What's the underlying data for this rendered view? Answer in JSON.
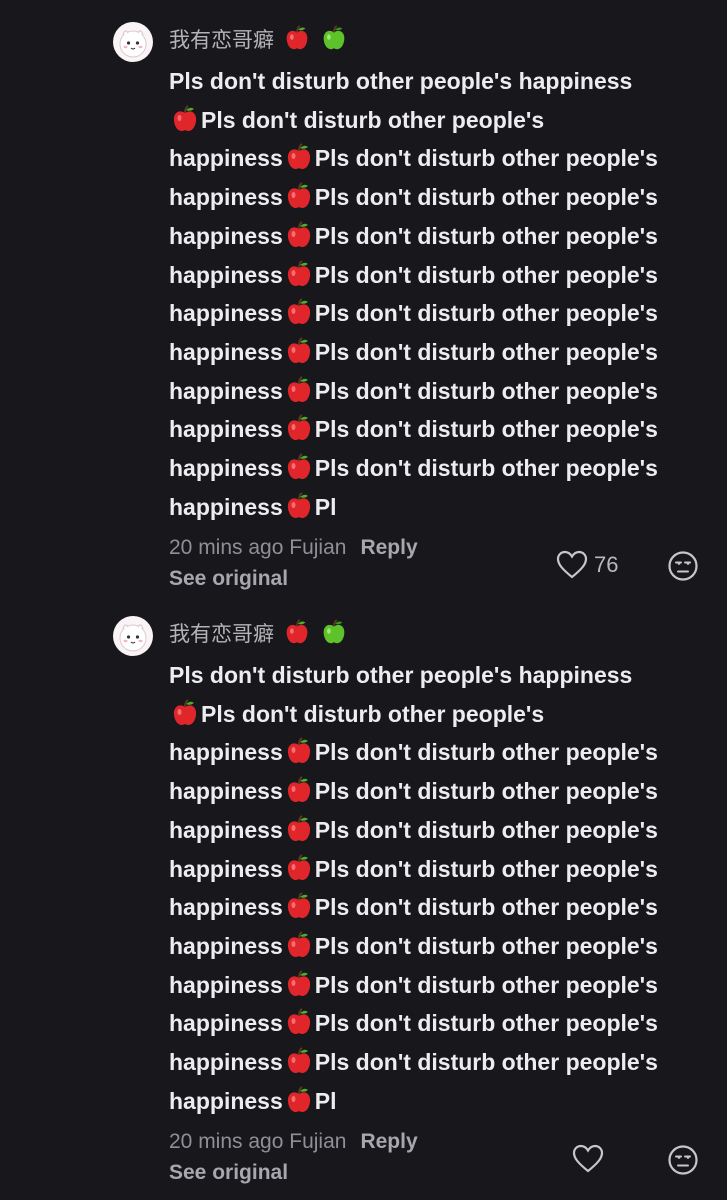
{
  "comments": [
    {
      "username": "我有恋哥癖",
      "username_emoji": [
        "red-apple-icon",
        "green-apple-icon"
      ],
      "lines": [
        {
          "pre": "Pls don't disturb other people's happiness",
          "apple": false,
          "post": ""
        },
        {
          "pre": "",
          "apple": true,
          "post": "Pls don't disturb other people's"
        },
        {
          "pre": "happiness",
          "apple": true,
          "post": "Pls don't disturb other people's"
        },
        {
          "pre": "happiness",
          "apple": true,
          "post": "Pls don't disturb other people's"
        },
        {
          "pre": "happiness",
          "apple": true,
          "post": "Pls don't disturb other people's"
        },
        {
          "pre": "happiness",
          "apple": true,
          "post": "Pls don't disturb other people's"
        },
        {
          "pre": "happiness",
          "apple": true,
          "post": "Pls don't disturb other people's"
        },
        {
          "pre": "happiness",
          "apple": true,
          "post": "Pls don't disturb other people's"
        },
        {
          "pre": "happiness",
          "apple": true,
          "post": "Pls don't disturb other people's"
        },
        {
          "pre": "happiness",
          "apple": true,
          "post": "Pls don't disturb other people's"
        },
        {
          "pre": "happiness",
          "apple": true,
          "post": "Pls don't disturb other people's"
        },
        {
          "pre": "happiness",
          "apple": true,
          "post": "Pl"
        }
      ],
      "meta": "20 mins ago Fujian",
      "reply_label": "Reply",
      "see_original_label": "See original",
      "like_count": "76"
    },
    {
      "username": "我有恋哥癖",
      "username_emoji": [
        "red-apple-icon",
        "green-apple-icon"
      ],
      "lines": [
        {
          "pre": "Pls don't disturb other people's happiness",
          "apple": false,
          "post": ""
        },
        {
          "pre": "",
          "apple": true,
          "post": "Pls don't disturb other people's"
        },
        {
          "pre": "happiness",
          "apple": true,
          "post": "Pls don't disturb other people's"
        },
        {
          "pre": "happiness",
          "apple": true,
          "post": "Pls don't disturb other people's"
        },
        {
          "pre": "happiness",
          "apple": true,
          "post": "Pls don't disturb other people's"
        },
        {
          "pre": "happiness",
          "apple": true,
          "post": "Pls don't disturb other people's"
        },
        {
          "pre": "happiness",
          "apple": true,
          "post": "Pls don't disturb other people's"
        },
        {
          "pre": "happiness",
          "apple": true,
          "post": "Pls don't disturb other people's"
        },
        {
          "pre": "happiness",
          "apple": true,
          "post": "Pls don't disturb other people's"
        },
        {
          "pre": "happiness",
          "apple": true,
          "post": "Pls don't disturb other people's"
        },
        {
          "pre": "happiness",
          "apple": true,
          "post": "Pls don't disturb other people's"
        },
        {
          "pre": "happiness",
          "apple": true,
          "post": "Pl"
        }
      ],
      "meta": "20 mins ago Fujian",
      "reply_label": "Reply",
      "see_original_label": "See original",
      "like_count": ""
    }
  ],
  "colors": {
    "background": "#17171c",
    "text": "#ededef",
    "muted": "#8f8f95",
    "red_apple": "#e0262b",
    "green_apple": "#5ec22a"
  }
}
